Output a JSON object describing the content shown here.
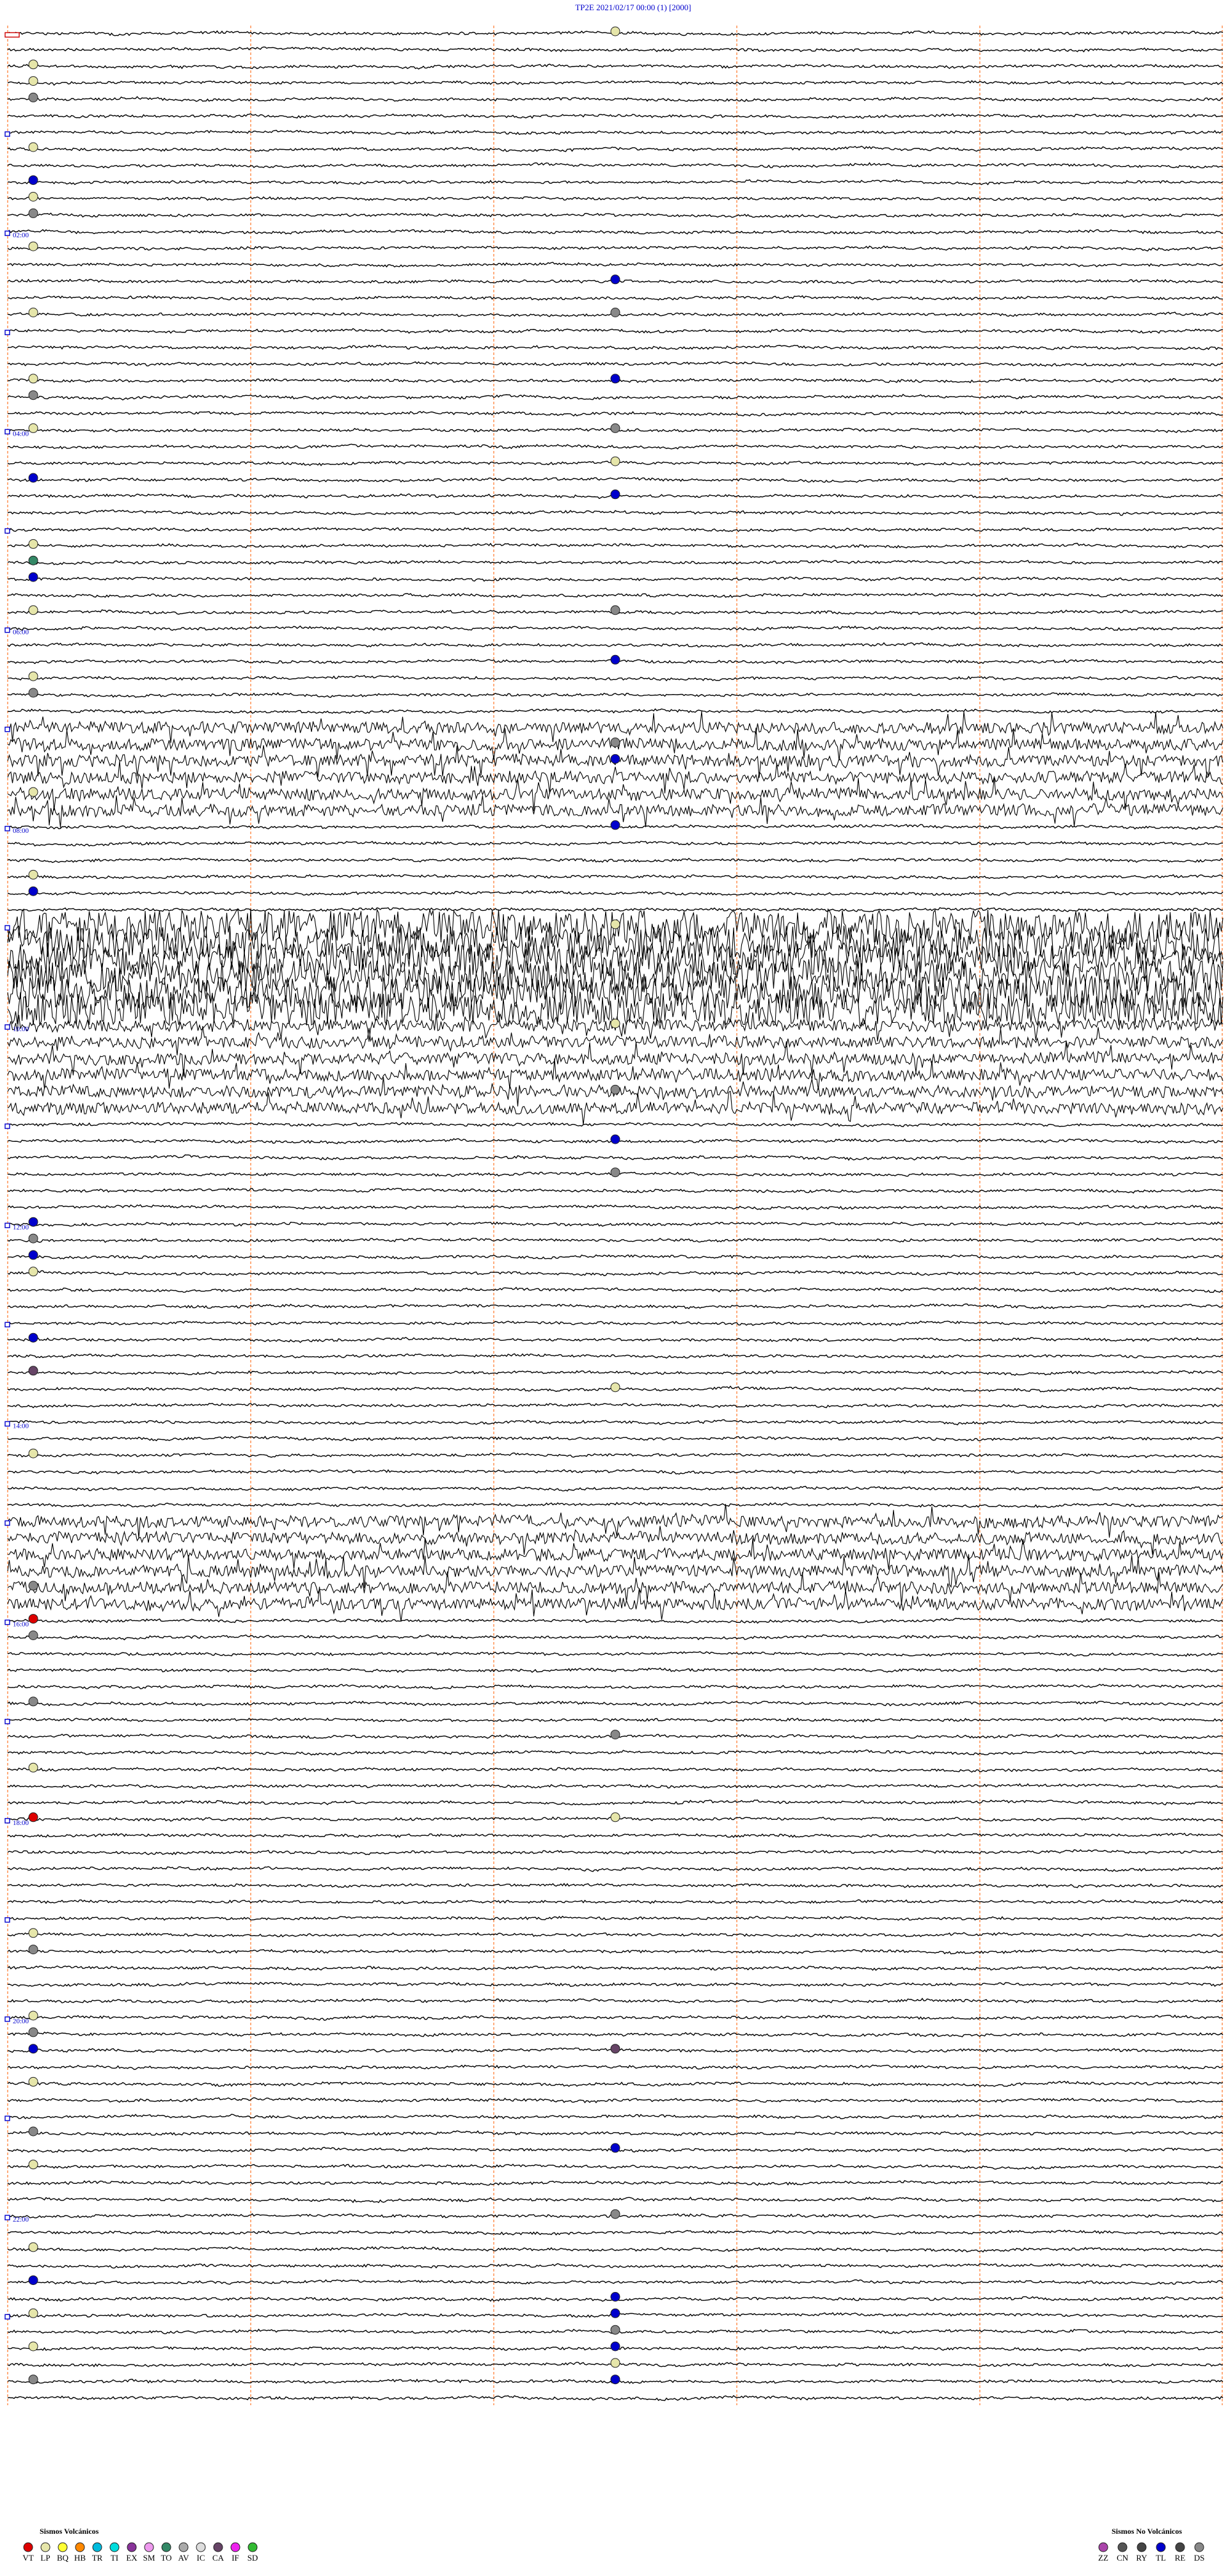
{
  "header": {
    "station": "TP2E",
    "datetime": "2021/02/17 00:00",
    "component": "(1)",
    "scale": "[2000]"
  },
  "chart_data": {
    "type": "helicorder",
    "title": "TP2E     2021/02/17 00:00     (1)     [2000]",
    "time_labels": [
      "02:00",
      "04:00",
      "06:00",
      "08:00",
      "10:00",
      "12:00",
      "14:00",
      "16:00",
      "18:00",
      "20:00",
      "22:00"
    ],
    "colors": {
      "trace": "#000000",
      "time_label": "#0000cc",
      "minute_grid": "#ff8844",
      "hour_marker": "#0000cc",
      "day_marker": "#cc0000"
    },
    "noisy_bands": [
      {
        "time": "07:00-08:00",
        "level": "moderate"
      },
      {
        "time": "09:00-10:00",
        "level": "strong"
      },
      {
        "time": "10:00-11:00",
        "level": "moderate"
      },
      {
        "time": "15:00-16:00",
        "level": "moderate"
      }
    ],
    "events": [
      {
        "type": "VT",
        "times": [
          "16:00",
          "18:00"
        ]
      },
      {
        "type": "LP",
        "times": [
          "00:05",
          "00:20",
          "00:30",
          "01:10",
          "01:40",
          "02:10",
          "02:50",
          "03:30",
          "04:00",
          "04:25",
          "05:10",
          "05:50",
          "06:30",
          "07:40",
          "08:30",
          "09:05",
          "10:05",
          "12:30",
          "13:45",
          "14:20",
          "17:30",
          "18:05",
          "19:10",
          "20:00",
          "20:40",
          "21:30",
          "22:20",
          "23:00",
          "23:20",
          "23:35"
        ]
      },
      {
        "type": "TO",
        "times": [
          "05:20"
        ]
      },
      {
        "type": "CA",
        "times": [
          "13:30",
          "20:25"
        ]
      },
      {
        "type": "TL",
        "times": [
          "01:30",
          "02:35",
          "03:35",
          "04:30",
          "04:45",
          "05:30",
          "06:25",
          "07:25",
          "08:05",
          "08:40",
          "11:15",
          "12:00",
          "12:20",
          "13:10",
          "20:20",
          "21:25",
          "22:40",
          "22:55",
          "23:05",
          "23:25",
          "23:45"
        ]
      },
      {
        "type": "DS",
        "times": [
          "00:40",
          "01:50",
          "02:55",
          "03:40",
          "04:05",
          "05:55",
          "06:40",
          "07:15",
          "10:45",
          "11:35",
          "12:10",
          "15:40",
          "16:10",
          "16:50",
          "17:15",
          "19:20",
          "20:10",
          "21:10",
          "22:05",
          "23:15",
          "23:40"
        ]
      }
    ]
  },
  "legend": {
    "volcanic": {
      "title": "Sismos Volcánicos",
      "items": [
        {
          "code": "VT",
          "color": "#dd0000"
        },
        {
          "code": "LP",
          "color": "#e6e6aa"
        },
        {
          "code": "BQ",
          "color": "#ffff33"
        },
        {
          "code": "HB",
          "color": "#ff8800"
        },
        {
          "code": "TR",
          "color": "#00bbdd"
        },
        {
          "code": "TI",
          "color": "#00dddd"
        },
        {
          "code": "EX",
          "color": "#883399"
        },
        {
          "code": "SM",
          "color": "#ee99ee"
        },
        {
          "code": "TO",
          "color": "#338866"
        },
        {
          "code": "AV",
          "color": "#aaaaaa"
        },
        {
          "code": "IC",
          "color": "#dddddd"
        },
        {
          "code": "CA",
          "color": "#664466"
        },
        {
          "code": "IF",
          "color": "#ee22ee"
        },
        {
          "code": "SD",
          "color": "#33bb33"
        }
      ]
    },
    "non_volcanic": {
      "title": "Sismos No Volcánicos",
      "items": [
        {
          "code": "ZZ",
          "color": "#aa44aa"
        },
        {
          "code": "CN",
          "color": "#555555"
        },
        {
          "code": "RY",
          "color": "#444444"
        },
        {
          "code": "TL",
          "color": "#0000cc"
        },
        {
          "code": "RE",
          "color": "#444444"
        },
        {
          "code": "DS",
          "color": "#888888"
        }
      ]
    }
  }
}
